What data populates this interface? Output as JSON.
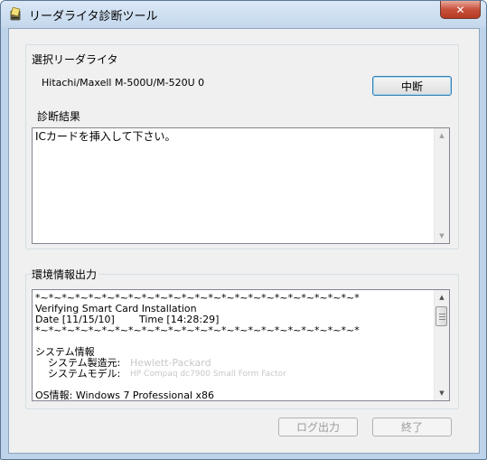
{
  "window": {
    "title": "リーダライタ診断ツール",
    "close_symbol": "✕"
  },
  "reader_group": {
    "label": "選択リーダライタ",
    "device_name": "Hitachi/Maxell M-500U/M-520U 0",
    "stop_button": "中断"
  },
  "result_group": {
    "label": "診断結果",
    "text": "ICカードを挿入して下さい。"
  },
  "env_group": {
    "label": "環境情報出力",
    "lines": {
      "sep1": "*~*~*~*~*~*~*~*~*~*~*~*~*~*~*~*~*~*~*~*~*~*~*~*~*",
      "verify": "Verifying Smart Card Installation",
      "date_label": "Date [11/15/10]",
      "time_label": "Time [14:28:29]",
      "sep2": "*~*~*~*~*~*~*~*~*~*~*~*~*~*~*~*~*~*~*~*~*~*~*~*~*",
      "sys_info": "システム情報",
      "maker_label": "システム製造元:",
      "maker_value": "Hewlett-Packard",
      "model_label": "システムモデル:",
      "model_value": "HP Compaq dc7900 Small Form Factor",
      "os_info": "OS情報: Windows 7 Professional x86"
    }
  },
  "footer": {
    "log_button": "ログ出力",
    "exit_button": "終了"
  },
  "icons": {
    "app": "card-reader-icon",
    "close": "close-icon",
    "scroll_up": "chevron-up-icon",
    "scroll_down": "chevron-down-icon"
  },
  "colors": {
    "frame": "#bcd3ea",
    "close_button": "#c7503a",
    "client_bg": "#f0f0f0"
  }
}
